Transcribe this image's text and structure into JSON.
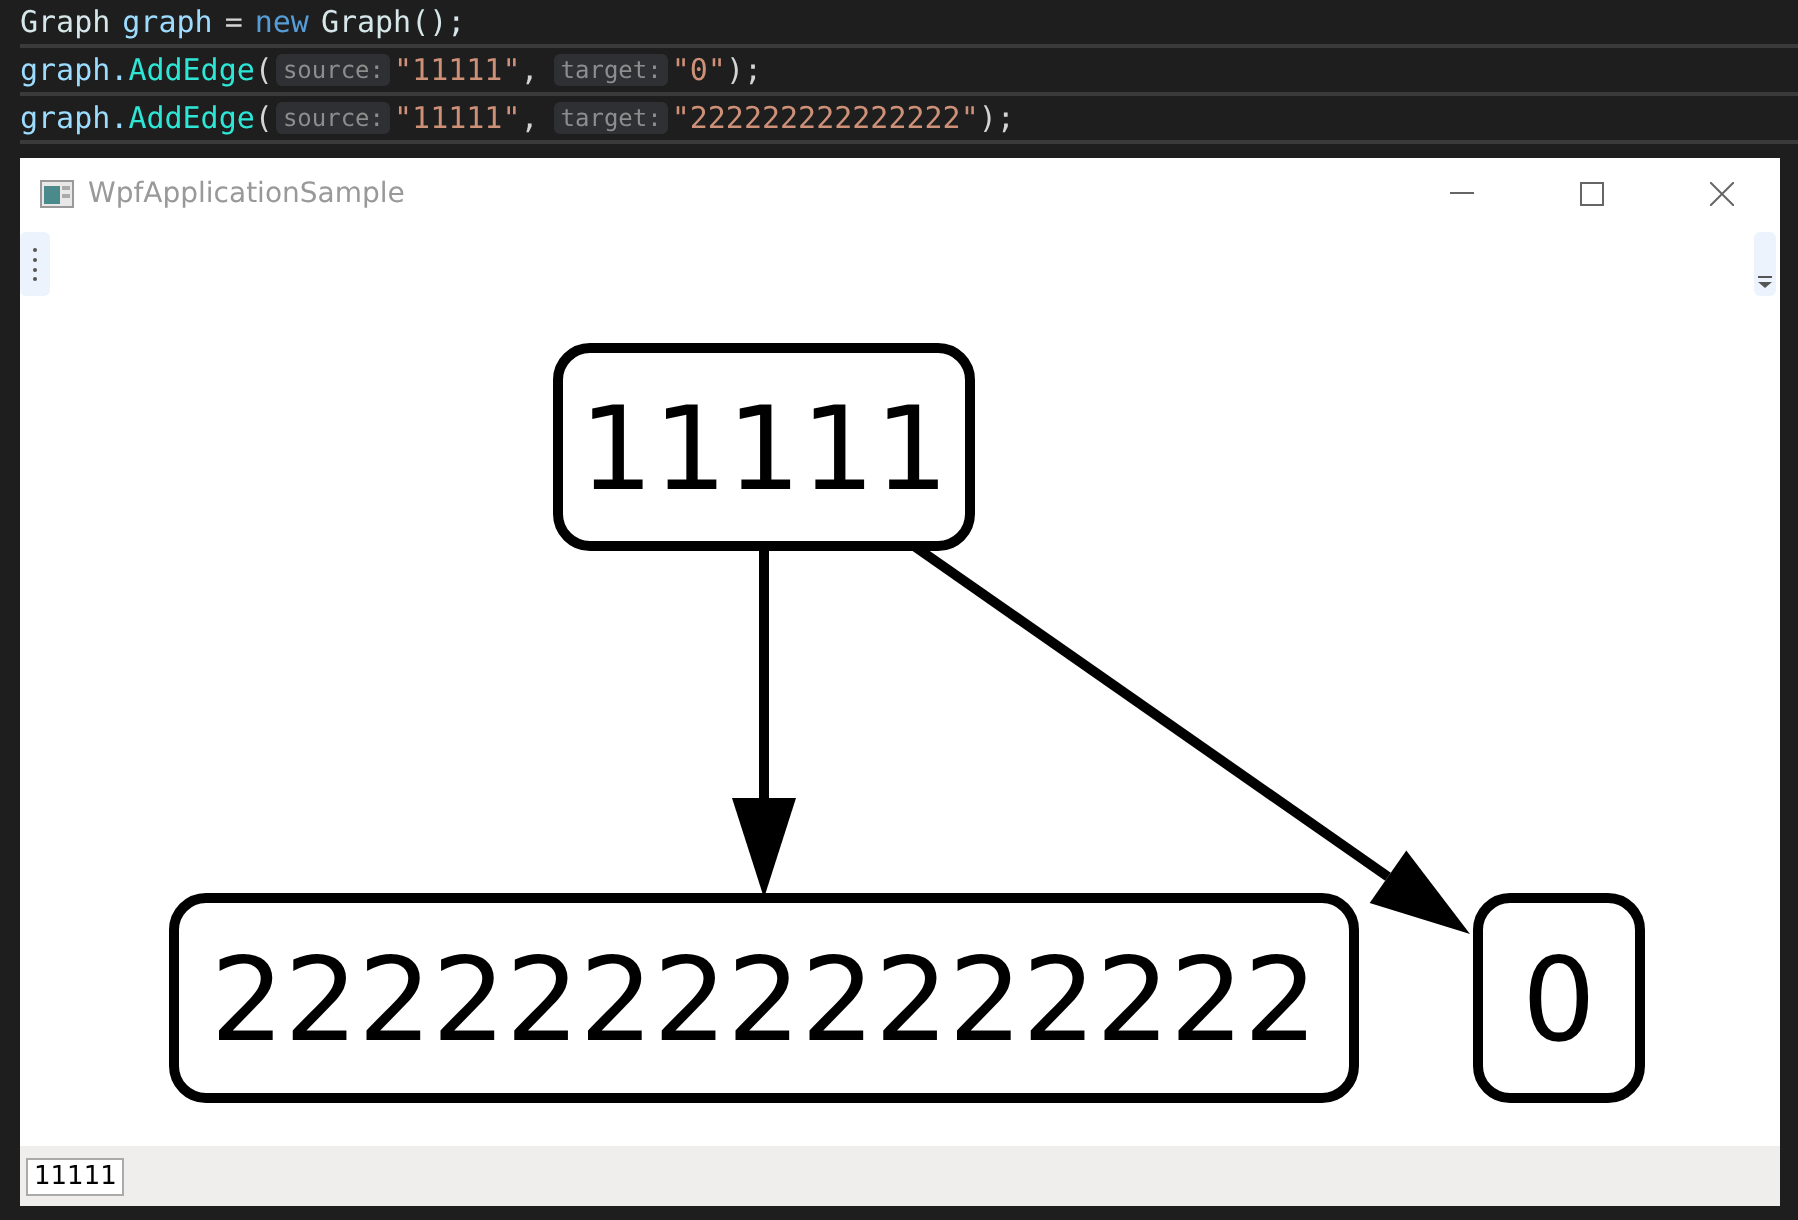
{
  "code_lines": [
    {
      "words": [
        [
          {
            "kind": "type",
            "text": "Graph"
          }
        ],
        [
          {
            "kind": "variable",
            "text": "graph"
          }
        ],
        [
          {
            "kind": "operator",
            "text": "="
          }
        ],
        [
          {
            "kind": "keyword",
            "text": "new"
          }
        ],
        [
          {
            "kind": "type",
            "text": "Graph();"
          }
        ]
      ]
    },
    {
      "words": [
        [
          {
            "kind": "variable",
            "text": "graph."
          },
          {
            "kind": "method",
            "text": "AddEdge"
          },
          {
            "kind": "plain",
            "text": "("
          },
          {
            "kind": "hint",
            "text": "source:"
          },
          {
            "kind": "string",
            "text": "\"11111\""
          },
          {
            "kind": "plain",
            "text": ","
          }
        ],
        [
          {
            "kind": "hint",
            "text": "target:"
          },
          {
            "kind": "string",
            "text": "\"0\""
          },
          {
            "kind": "plain",
            "text": ");"
          }
        ]
      ]
    },
    {
      "words": [
        [
          {
            "kind": "variable",
            "text": "graph."
          },
          {
            "kind": "method",
            "text": "AddEdge"
          },
          {
            "kind": "plain",
            "text": "("
          },
          {
            "kind": "hint",
            "text": "source:"
          },
          {
            "kind": "string",
            "text": "\"11111\""
          },
          {
            "kind": "plain",
            "text": ","
          }
        ],
        [
          {
            "kind": "hint",
            "text": "target:"
          },
          {
            "kind": "string",
            "text": "\"222222222222222\""
          },
          {
            "kind": "plain",
            "text": ");"
          }
        ]
      ]
    }
  ],
  "window": {
    "title": "WpfApplicationSample"
  },
  "graph": {
    "root": {
      "label": "11111",
      "children": [
        {
          "label": "222222222222222"
        },
        {
          "label": "0"
        }
      ]
    }
  },
  "status_bar": {
    "text": "11111"
  }
}
